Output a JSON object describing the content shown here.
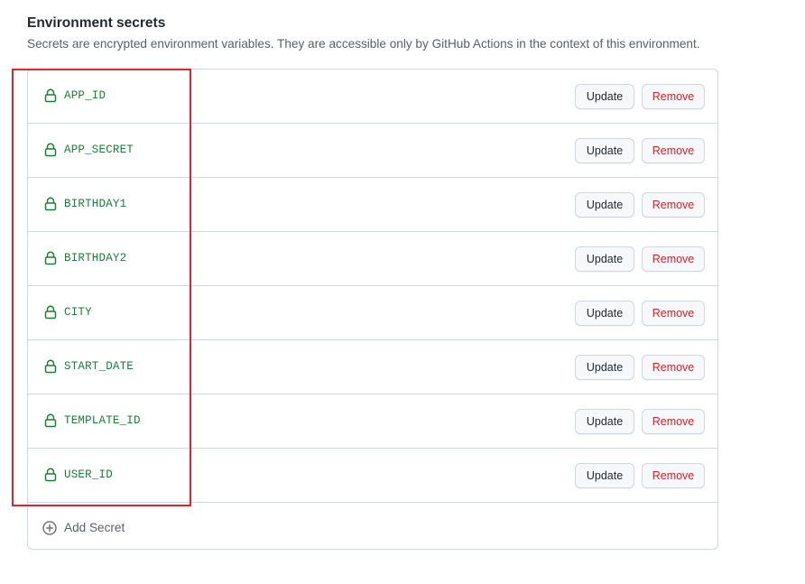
{
  "section": {
    "title": "Environment secrets",
    "description": "Secrets are encrypted environment variables. They are accessible only by GitHub Actions in the context of this environment."
  },
  "secrets": [
    {
      "name": "APP_ID",
      "update_label": "Update",
      "remove_label": "Remove"
    },
    {
      "name": "APP_SECRET",
      "update_label": "Update",
      "remove_label": "Remove"
    },
    {
      "name": "BIRTHDAY1",
      "update_label": "Update",
      "remove_label": "Remove"
    },
    {
      "name": "BIRTHDAY2",
      "update_label": "Update",
      "remove_label": "Remove"
    },
    {
      "name": "CITY",
      "update_label": "Update",
      "remove_label": "Remove"
    },
    {
      "name": "START_DATE",
      "update_label": "Update",
      "remove_label": "Remove"
    },
    {
      "name": "TEMPLATE_ID",
      "update_label": "Update",
      "remove_label": "Remove"
    },
    {
      "name": "USER_ID",
      "update_label": "Update",
      "remove_label": "Remove"
    }
  ],
  "add_secret": {
    "label": "Add Secret",
    "icon": "plus-circle-icon"
  },
  "icons": {
    "secret_icon": "lock-icon"
  },
  "colors": {
    "secret_name": "#1a7f37",
    "remove_text": "#cf222e",
    "highlight": "#e0242b",
    "border": "#d0d7de"
  }
}
